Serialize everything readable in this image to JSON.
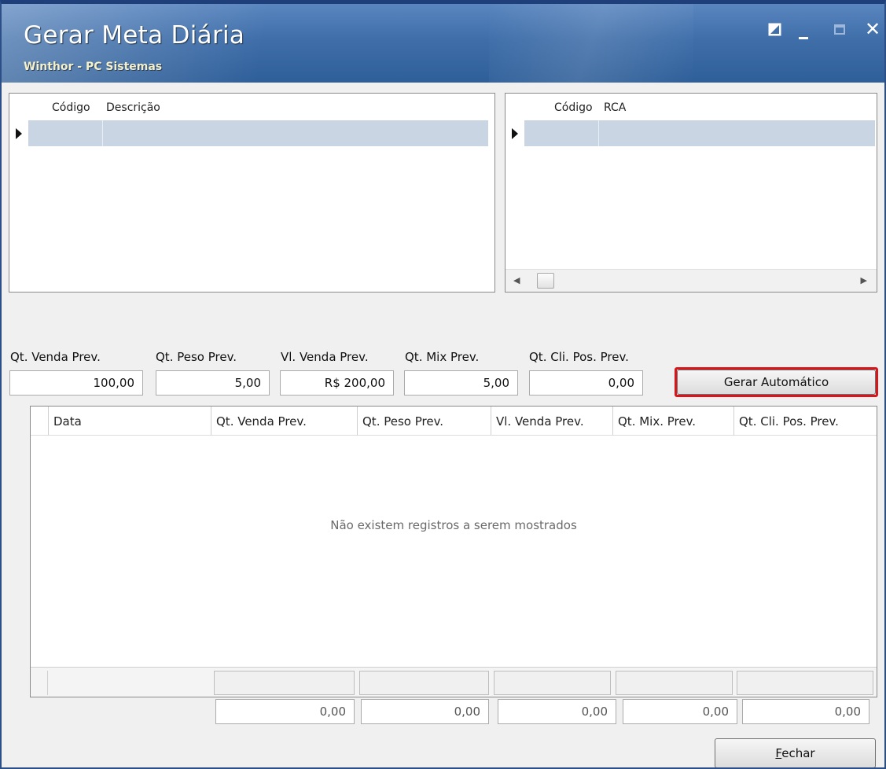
{
  "window": {
    "title": "Gerar Meta Diária",
    "subtitle": "Winthor - PC Sistemas"
  },
  "grid_left": {
    "columns": [
      "Código",
      "Descrição"
    ]
  },
  "grid_right": {
    "columns": [
      "Código",
      "RCA"
    ]
  },
  "fields": [
    {
      "label": "Qt. Venda Prev.",
      "value": "100,00"
    },
    {
      "label": "Qt. Peso Prev.",
      "value": "5,00"
    },
    {
      "label": "Vl. Venda Prev.",
      "value": "R$ 200,00"
    },
    {
      "label": "Qt. Mix Prev.",
      "value": "5,00"
    },
    {
      "label": "Qt. Cli. Pos. Prev.",
      "value": "0,00"
    }
  ],
  "buttons": {
    "gerar_automatico": "Gerar Automático",
    "fechar_accel": "F",
    "fechar_rest": "echar"
  },
  "main_grid": {
    "columns": [
      "Data",
      "Qt. Venda Prev.",
      "Qt. Peso Prev.",
      "Vl. Venda Prev.",
      "Qt. Mix. Prev.",
      "Qt. Cli. Pos. Prev."
    ],
    "empty_message": "Não existem registros a serem mostrados"
  },
  "totals": [
    "0,00",
    "0,00",
    "0,00",
    "0,00",
    "0,00"
  ],
  "colors": {
    "highlight": "#d9151b",
    "selected_row": "#c9d5e2",
    "titlebar": "#3f6ea9"
  }
}
